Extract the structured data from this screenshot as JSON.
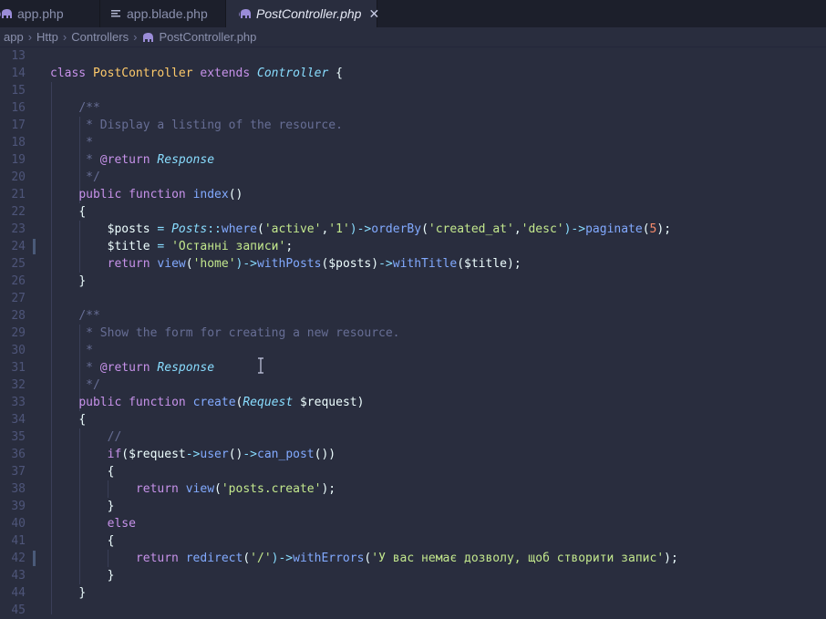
{
  "tabs": [
    {
      "label": "app.php",
      "icon": "php-elephant-icon"
    },
    {
      "label": "app.blade.php",
      "icon": "file-lines-icon"
    },
    {
      "label": "PostController.php",
      "icon": "php-elephant-icon",
      "close": "✕"
    }
  ],
  "breadcrumb": {
    "items": [
      "app",
      "Http",
      "Controllers",
      "PostController.php"
    ],
    "separator": "›"
  },
  "colors": {
    "background": "#292d3e",
    "keyword": "#c792ea",
    "function": "#82aaff",
    "string": "#c3e88d",
    "comment": "#676e95",
    "class": "#ffcb6b",
    "type": "#89ddff",
    "number": "#f78c6c"
  },
  "editor": {
    "line_numbers": [
      "13",
      "14",
      "15",
      "16",
      "17",
      "18",
      "19",
      "20",
      "21",
      "22",
      "23",
      "24",
      "25",
      "26",
      "27",
      "28",
      "29",
      "30",
      "31",
      "32",
      "33",
      "34",
      "35",
      "36",
      "37",
      "38",
      "39",
      "40",
      "41",
      "42",
      "43",
      "44",
      "45"
    ],
    "code": {
      "l14": {
        "a": "class",
        "b": "PostController",
        "c": "extends",
        "d": "Controller",
        "e": "{"
      },
      "l16": "/**",
      "l17": " * Display a listing of the resource.",
      "l18": " *",
      "l19": {
        "a": " * ",
        "b": "@return",
        "c": "Response"
      },
      "l20": " */",
      "l21": {
        "a": "public",
        "b": "function",
        "c": "index",
        "d": "()"
      },
      "l22": "{",
      "l23": {
        "a": "$posts",
        "b": "=",
        "c": "Posts",
        "d": "::",
        "e": "where",
        "f": "(",
        "g": "'active'",
        "h": ",",
        "i": "'1'",
        "j": ")->",
        "k": "orderBy",
        "l": "(",
        "m": "'created_at'",
        "n": ",",
        "o": "'desc'",
        "p": ")->",
        "q": "paginate",
        "r": "(",
        "s": "5",
        "t": ");"
      },
      "l24": {
        "a": "$title",
        "b": "=",
        "c": "'Останні записи'",
        "d": ";"
      },
      "l25": {
        "a": "return",
        "b": "view",
        "c": "(",
        "d": "'home'",
        "e": ")->",
        "f": "withPosts",
        "g": "($posts)",
        "h": "->",
        "i": "withTitle",
        "j": "($title);"
      },
      "l26": "}",
      "l28": "/**",
      "l29": " * Show the form for creating a new resource.",
      "l30": " *",
      "l31": {
        "a": " * ",
        "b": "@return",
        "c": "Response"
      },
      "l32": " */",
      "l33": {
        "a": "public",
        "b": "function",
        "c": "create",
        "d": "(",
        "e": "Request",
        "f": "$request)"
      },
      "l34": "{",
      "l35": "//",
      "l36": {
        "a": "if",
        "b": "($request",
        "c": "->",
        "d": "user",
        "e": "()",
        "f": "->",
        "g": "can_post",
        "h": "())"
      },
      "l37": "{",
      "l38": {
        "a": "return",
        "b": "view",
        "c": "(",
        "d": "'posts.create'",
        "e": ");"
      },
      "l39": "}",
      "l40": "else",
      "l41": "{",
      "l42": {
        "a": "return",
        "b": "redirect",
        "c": "(",
        "d": "'/'",
        "e": ")->",
        "f": "withErrors",
        "g": "(",
        "h": "'У вас немає дозволу, щоб створити запис'",
        "i": ");"
      },
      "l43": "}",
      "l44": "}"
    }
  }
}
